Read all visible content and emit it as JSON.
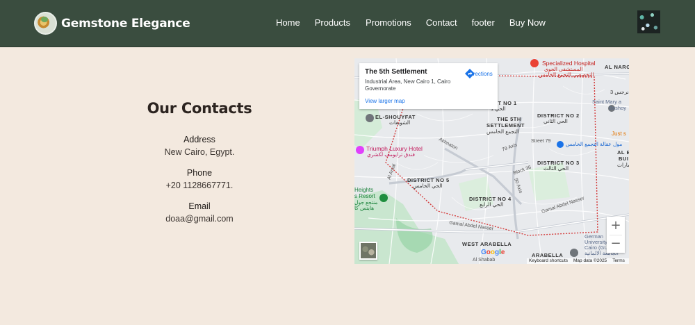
{
  "header": {
    "brand": "Gemstone Elegance",
    "nav": [
      "Home",
      "Products",
      "Promotions",
      "Contact",
      "footer",
      "Buy Now"
    ]
  },
  "contacts": {
    "title": "Our Contacts",
    "address_label": "Address",
    "address_value": "New Cairo, Egypt.",
    "phone_label": "Phone",
    "phone_value": "+20 1128667771.",
    "email_label": "Email",
    "email_value": "doaa@gmail.com"
  },
  "map": {
    "place_name": "The 5th Settlement",
    "place_address": "Industrial Area, New Cairo 1, Cairo Governorate",
    "view_larger": "View larger map",
    "directions": "Directions",
    "zoom_in": "+",
    "zoom_out": "−",
    "google": "Google",
    "keyboard_shortcuts": "Keyboard shortcuts",
    "map_data": "Map data ©2025",
    "terms": "Terms",
    "labels": {
      "specialized_hospital": "Specialized Hospital",
      "specialized_hospital_ar1": "المستشفى الجوي",
      "specialized_hospital_ar2": "التخصصي التجمع الخامس",
      "al_narges": "AL NARGE",
      "al_narges_ar": "نرجس 3",
      "saint_mary": "Saint Mary a",
      "beshoy": "Beshoy",
      "just": "Just s",
      "el_shouyfat": "EL-SHOUYFAT",
      "el_shouyfat_ar": "الشويفات",
      "district1": "DISTRICT NO 1",
      "district1_ar": "الحي 1",
      "fifth_settlement_1": "THE 5TH",
      "fifth_settlement_2": "SETTLEMENT",
      "fifth_settlement_ar": "التجمع الخامس",
      "district2": "DISTRICT NO 2",
      "district2_ar": "الحي الثاني",
      "mall": "مول عقالة التجمع الخامس",
      "street79": "Street 79",
      "akhnaton": "Akhnaton",
      "axis79": "79 Axis",
      "triumph": "Triumph Luxury Hotel",
      "triumph_ar": "فندق ترايومف لكشري",
      "al_amal": "Al Amal",
      "district3": "DISTRICT NO 3",
      "district3_ar": "الحي الثالث",
      "al_bu": "AL B",
      "bui": "BUI",
      "block36": "Block 36",
      "district5": "DISTRICT NO 5",
      "district5_ar": "الحي الخامس",
      "heights": "Heights",
      "resort": "s Resort",
      "resort_ar1": "منتجع جول",
      "resort_ar2": "هايتس كا",
      "axis90": "90 Axis",
      "district4": "DISTRICT NO 4",
      "district4_ar": "الحي الرابع",
      "gamal1": "Gamal Abdel Nasser",
      "gamal2": "Gamal Abdel Nasser",
      "west_arabella": "WEST ARABELLA",
      "arabella": "ARABELLA",
      "al_shabab": "Al Shabab",
      "german_uni1": "German",
      "german_uni2": "University",
      "german_uni3": "Cairo (GUC)",
      "german_uni_ar": "الجامعة الالمانية",
      "aarab": "عمارات"
    }
  },
  "colors": {
    "header_bg": "#3a4d3f",
    "page_bg": "#f3e9df",
    "link_blue": "#1a73e8",
    "boundary_red": "#d33c3c"
  }
}
